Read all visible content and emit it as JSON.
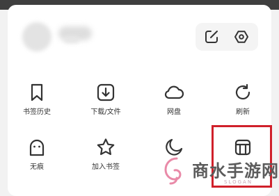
{
  "header": {
    "edit_icon": "edit-icon",
    "settings_icon": "hexagon-settings-icon"
  },
  "grid": {
    "tiles": [
      {
        "label": "书签历史",
        "icon": "bookmark-icon"
      },
      {
        "label": "下载/文件",
        "icon": "download-icon"
      },
      {
        "label": "网盘",
        "icon": "cloud-icon"
      },
      {
        "label": "刷新",
        "icon": "refresh-icon"
      },
      {
        "label": "无痕",
        "icon": "ghost-icon"
      },
      {
        "label": "加入书签",
        "icon": "star-icon"
      },
      {
        "label": "",
        "icon": "moon-icon"
      },
      {
        "label": "",
        "icon": "toolbox-icon"
      }
    ]
  },
  "watermark": {
    "text": "商水手游网",
    "sub": "SLOGAN"
  },
  "colors": {
    "highlight": "#d0202a",
    "icon": "#333333",
    "background": "#ffffff"
  }
}
